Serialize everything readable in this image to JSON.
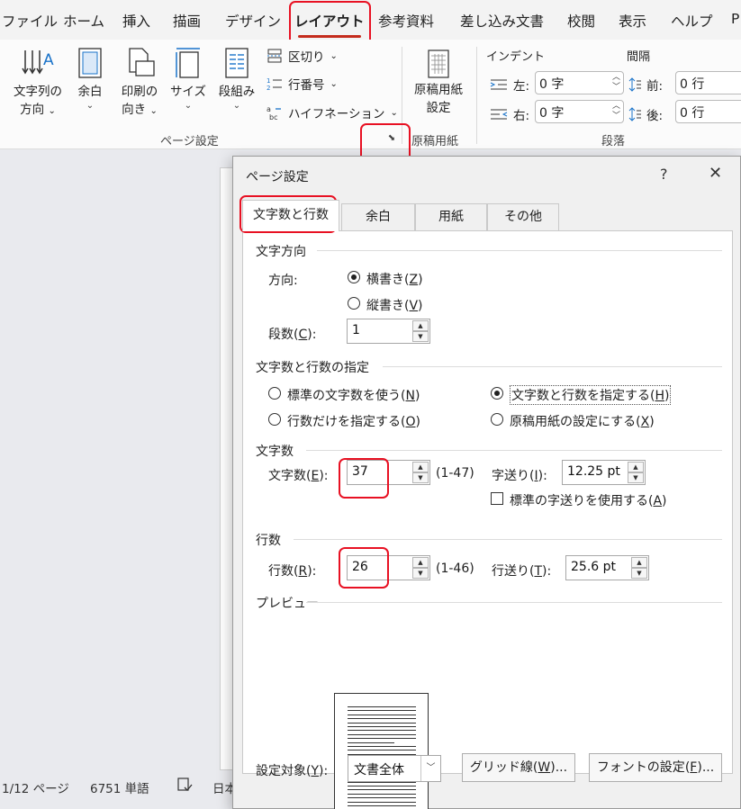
{
  "ribbon_tabs": [
    "ファイル",
    "ホーム",
    "挿入",
    "描画",
    "デザイン",
    "レイアウト",
    "参考資料",
    "差し込み文書",
    "校閲",
    "表示",
    "ヘルプ",
    "P"
  ],
  "page_setup_group": {
    "text_direction": [
      "文字列の",
      "方向"
    ],
    "margins": "余白",
    "orientation": [
      "印刷の",
      "向き"
    ],
    "size": "サイズ",
    "columns": "段組み",
    "breaks": "区切り",
    "line_numbers": "行番号",
    "hyphenation": "ハイフネーション",
    "label": "ページ設定"
  },
  "manuscript_group": {
    "button": [
      "原稿用紙",
      "設定"
    ],
    "label": "原稿用紙"
  },
  "paragraph_group": {
    "indent_header": "インデント",
    "spacing_header": "間隔",
    "left_label": "左:",
    "left_value": "0 字",
    "right_label": "右:",
    "right_value": "0 字",
    "before_label": "前:",
    "before_value": "0 行",
    "after_label": "後:",
    "after_value": "0 行",
    "label": "段落"
  },
  "status_bar": {
    "page": "1/12 ページ",
    "words": "6751 単語",
    "language": "日本"
  },
  "dialog": {
    "title": "ページ設定",
    "help": "?",
    "close": "✕",
    "tabs": [
      "文字数と行数",
      "余白",
      "用紙",
      "その他"
    ],
    "text_direction": {
      "header": "文字方向",
      "direction_label": "方向:",
      "horizontal": "横書き",
      "horizontal_key": "Z",
      "vertical": "縦書き",
      "vertical_key": "V",
      "columns_label": "段数",
      "columns_key": "C",
      "columns_value": "1"
    },
    "grid": {
      "header": "文字数と行数の指定",
      "opt_standard": "標準の文字数を使う",
      "opt_standard_key": "N",
      "opt_lines_only": "行数だけを指定する",
      "opt_lines_only_key": "O",
      "opt_chars_lines": "文字数と行数を指定する",
      "opt_chars_lines_key": "H",
      "opt_manuscript": "原稿用紙の設定にする",
      "opt_manuscript_key": "X",
      "selected": "opt_chars_lines"
    },
    "chars": {
      "header": "文字数",
      "label": "文字数",
      "key": "E",
      "value": "37",
      "range": "(1-47)",
      "pitch_label": "字送り",
      "pitch_key": "I",
      "pitch_value": "12.25 pt",
      "default_pitch": "標準の字送りを使用する",
      "default_pitch_key": "A",
      "default_pitch_checked": false
    },
    "lines": {
      "header": "行数",
      "label": "行数",
      "key": "R",
      "value": "26",
      "range": "(1-46)",
      "pitch_label": "行送り",
      "pitch_key": "T",
      "pitch_value": "25.6 pt"
    },
    "preview": {
      "header": "プレビュー"
    },
    "apply_to": {
      "label": "設定対象",
      "key": "Y",
      "value": "文書全体"
    },
    "gridlines_button": "グリッド線",
    "gridlines_key": "W",
    "font_button": "フォントの設定",
    "font_key": "F",
    "ellipsis": "..."
  },
  "highlight_color": "#e81123"
}
